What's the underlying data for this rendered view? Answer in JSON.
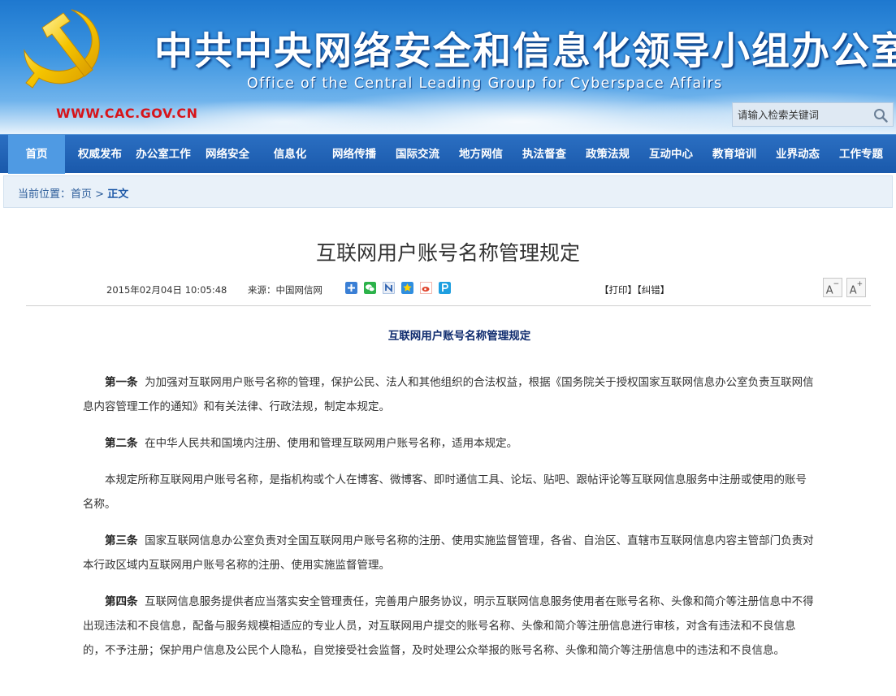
{
  "header": {
    "title": "中共中央网络安全和信息化领导小组办公室",
    "subtitle": "Office of the Central Leading Group for Cyberspace Affairs",
    "url": "WWW.CAC.GOV.CN",
    "search_placeholder": "请输入检索关键词",
    "colors": {
      "banner": "#1e78cf",
      "url_red": "#d7141a",
      "emblem_yellow": "#f5c400"
    }
  },
  "nav": {
    "items": [
      "首页",
      "权威发布",
      "办公室工作",
      "网络安全",
      "信息化",
      "网络传播",
      "国际交流",
      "地方网信",
      "执法督查",
      "政策法规",
      "互动中心",
      "教育培训",
      "业界动态",
      "工作专题"
    ],
    "active_index": 0
  },
  "breadcrumb": {
    "prefix": "当前位置：",
    "home": "首页",
    "separator": " > ",
    "current": "正文"
  },
  "article": {
    "title": "互联网用户账号名称管理规定",
    "date": "2015年02月04日 10:05:48",
    "source_label": "来源：",
    "source": "中国网信网",
    "share_icons": [
      "plus-share-icon",
      "wechat-icon",
      "n-share-icon",
      "qzone-icon",
      "weibo-icon",
      "p-share-icon"
    ],
    "print_label": "【打印】",
    "correct_label": "【纠错】",
    "font_smaller": "A",
    "font_larger": "A",
    "doc_heading": "互联网用户账号名称管理规定",
    "paragraphs": [
      {
        "lead": "第一条",
        "text": "为加强对互联网用户账号名称的管理，保护公民、法人和其他组织的合法权益，根据《国务院关于授权国家互联网信息办公室负责互联网信息内容管理工作的通知》和有关法律、行政法规，制定本规定。"
      },
      {
        "lead": "第二条",
        "text": "在中华人民共和国境内注册、使用和管理互联网用户账号名称，适用本规定。"
      },
      {
        "lead": "",
        "text": "本规定所称互联网用户账号名称，是指机构或个人在博客、微博客、即时通信工具、论坛、贴吧、跟帖评论等互联网信息服务中注册或使用的账号名称。"
      },
      {
        "lead": "第三条",
        "text": "国家互联网信息办公室负责对全国互联网用户账号名称的注册、使用实施监督管理，各省、自治区、直辖市互联网信息内容主管部门负责对本行政区域内互联网用户账号名称的注册、使用实施监督管理。"
      },
      {
        "lead": "第四条",
        "text": "互联网信息服务提供者应当落实安全管理责任，完善用户服务协议，明示互联网信息服务使用者在账号名称、头像和简介等注册信息中不得出现违法和不良信息，配备与服务规模相适应的专业人员，对互联网用户提交的账号名称、头像和简介等注册信息进行审核，对含有违法和不良信息的，不予注册；保护用户信息及公民个人隐私，自觉接受社会监督，及时处理公众举报的账号名称、头像和简介等注册信息中的违法和不良信息。"
      }
    ]
  }
}
